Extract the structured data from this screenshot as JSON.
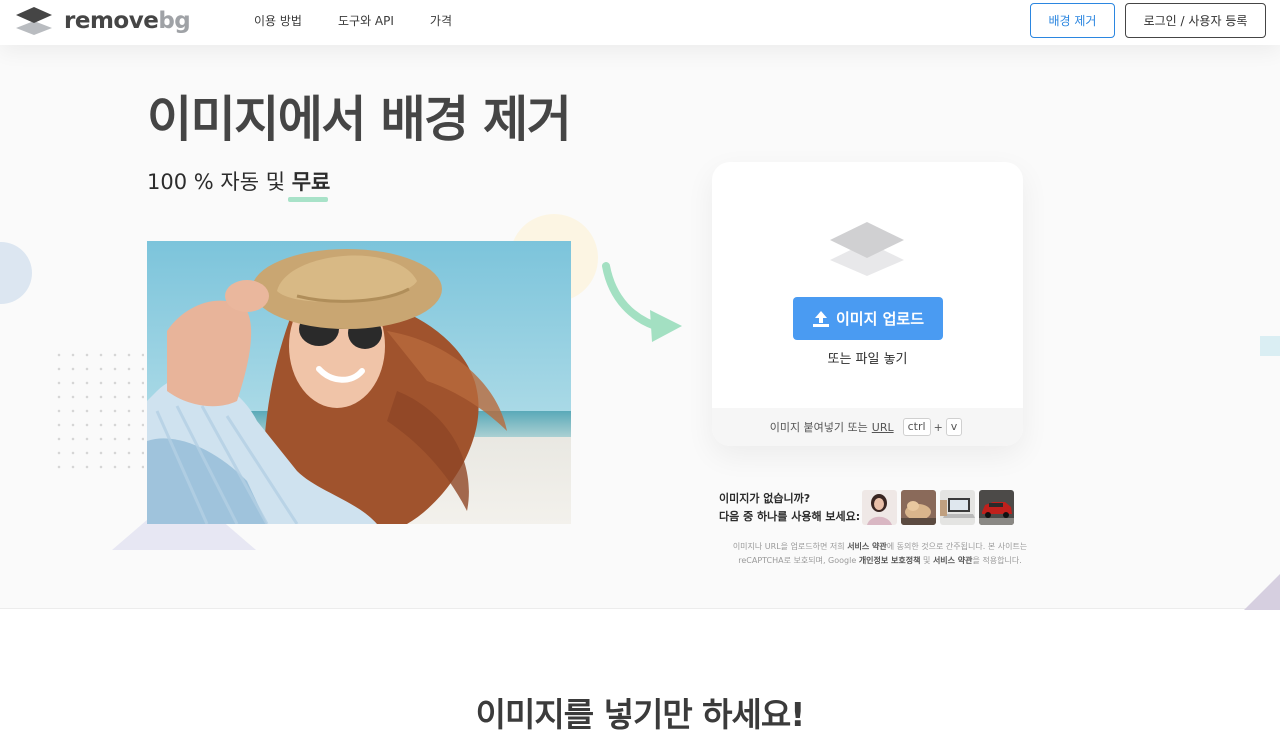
{
  "header": {
    "logo_remove": "remove",
    "logo_bg": "bg",
    "nav": [
      "이용 방법",
      "도구와 API",
      "가격"
    ],
    "remove_bg_button": "배경 제거",
    "login_button": "로그인 / 사용자 등록"
  },
  "hero": {
    "title": "이미지에서 배경 제거",
    "subtitle_prefix": "100 % 자동 및 ",
    "subtitle_free": "무료"
  },
  "upload": {
    "button_label": "이미지 업로드",
    "drop_text": "또는 파일 놓기",
    "paste_text": "이미지 붙여넣기 또는",
    "url_text": "URL",
    "kbd_ctrl": "ctrl",
    "kbd_plus": "+",
    "kbd_v": "v"
  },
  "samples": {
    "line1": "이미지가 없습니까?",
    "line2": "다음 중 하나를 사용해 보세요:"
  },
  "legal": {
    "t1": "이미지나 URL을 업로드하면 저희 ",
    "b1": "서비스 약관",
    "t2": "에 동의한 것으로 간주됩니다. 본 사이트는",
    "t3": "reCAPTCHA로 보호되며, Google ",
    "b2": "개인정보 보호정책",
    "t4": " 및 ",
    "b3": "서비스 약관",
    "t5": "을 적용합니다."
  },
  "bottom_title": "이미지를 넣기만 하세요!",
  "colors": {
    "accent_blue": "#4a9bf2",
    "link_blue": "#2b86e0",
    "underline_green": "#a8e2c8",
    "arrow_green": "#a3e0c2"
  }
}
